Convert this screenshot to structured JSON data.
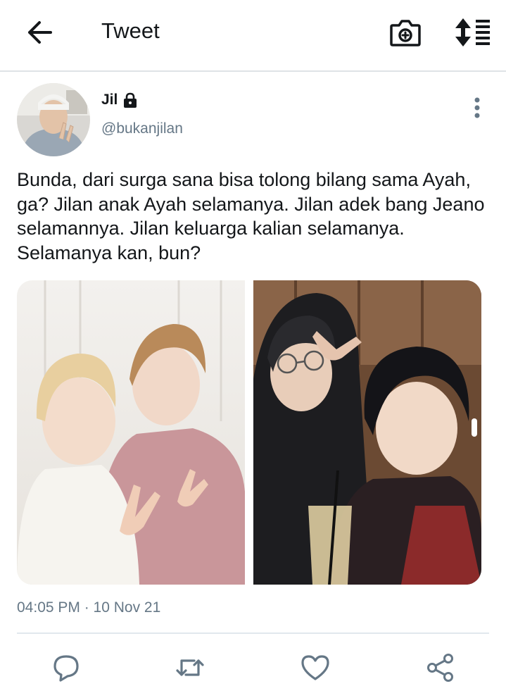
{
  "header": {
    "title": "Tweet",
    "icons": {
      "back": "arrow-left-icon",
      "camera": "camera-add-icon",
      "sort": "sort-icon"
    }
  },
  "author": {
    "display_name": "Jil",
    "handle": "@bukanjilan",
    "protected": true
  },
  "tweet": {
    "text": "Bunda, dari surga sana bisa tolong bilang sama Ayah, ga? Jilan anak Ayah selamanya. Jilan adek bang Jeano selamannya. Jilan keluarga kalian selamanya. Selamanya kan, bun?",
    "media_count": 2,
    "timestamp": "04:05 PM · 10 Nov 21"
  },
  "actions": [
    "reply-icon",
    "retweet-icon",
    "like-icon",
    "share-icon"
  ],
  "colors": {
    "text": "#14171a",
    "secondary": "#657786",
    "accent": "#1da1f2",
    "divider": "#e1e8ed"
  }
}
